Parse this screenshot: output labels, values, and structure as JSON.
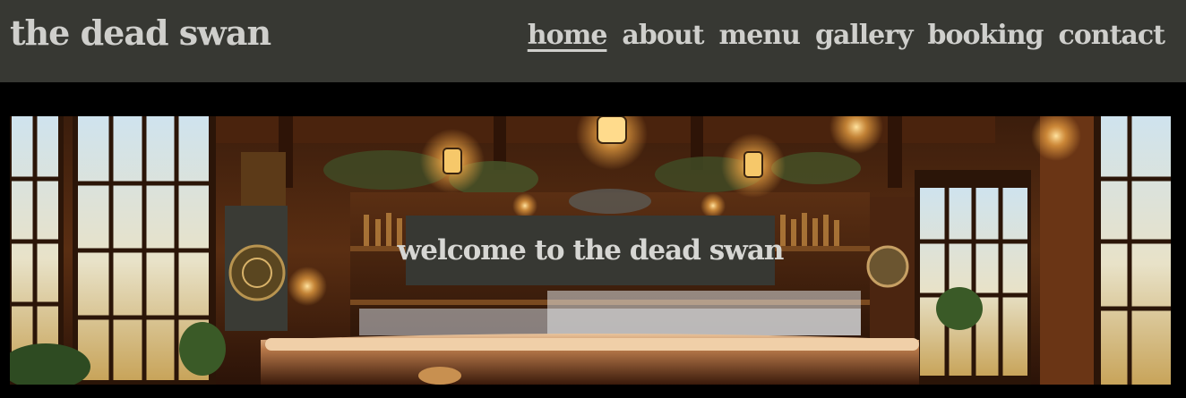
{
  "header": {
    "brand": "the dead swan",
    "background": "#373833",
    "text_color": "#cfcfcc"
  },
  "nav": {
    "items": [
      {
        "label": "home",
        "active": true
      },
      {
        "label": "about",
        "active": false
      },
      {
        "label": "menu",
        "active": false
      },
      {
        "label": "gallery",
        "active": false
      },
      {
        "label": "booking",
        "active": false
      },
      {
        "label": "contact",
        "active": false
      }
    ]
  },
  "hero": {
    "image": "bar-interior-image",
    "welcome_text": "welcome to the dead swan"
  }
}
